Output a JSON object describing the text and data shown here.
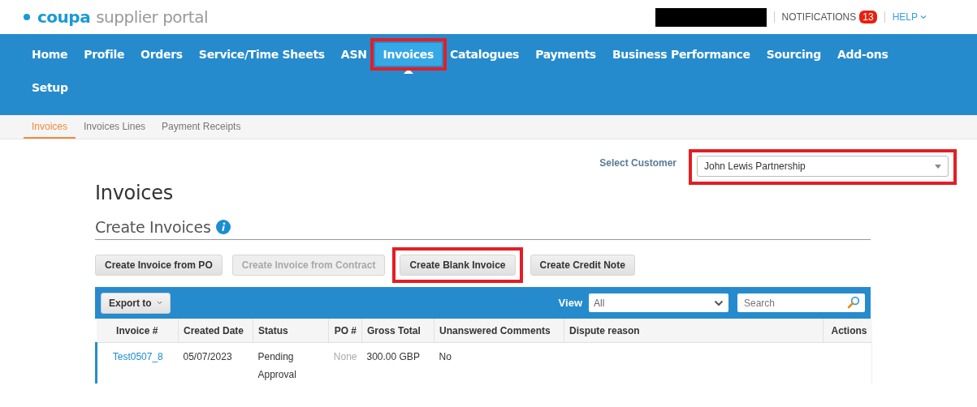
{
  "header": {
    "logo_brand": "coupa",
    "logo_product": "supplier portal",
    "user_redacted": true,
    "notifications": {
      "label": "NOTIFICATIONS",
      "count": "13"
    },
    "help": "HELP"
  },
  "nav": {
    "rows": [
      [
        {
          "label": "Home",
          "selected": false,
          "highlighted": false
        },
        {
          "label": "Profile",
          "selected": false,
          "highlighted": false
        },
        {
          "label": "Orders",
          "selected": false,
          "highlighted": false
        },
        {
          "label": "Service/Time Sheets",
          "selected": false,
          "highlighted": false
        },
        {
          "label": "ASN",
          "selected": false,
          "highlighted": false
        },
        {
          "label": "Invoices",
          "selected": true,
          "highlighted": true
        },
        {
          "label": "Catalogues",
          "selected": false,
          "highlighted": false
        },
        {
          "label": "Payments",
          "selected": false,
          "highlighted": false
        },
        {
          "label": "Business Performance",
          "selected": false,
          "highlighted": false
        },
        {
          "label": "Sourcing",
          "selected": false,
          "highlighted": false
        },
        {
          "label": "Add-ons",
          "selected": false,
          "highlighted": false
        }
      ],
      [
        {
          "label": "Setup",
          "selected": false,
          "highlighted": false
        }
      ]
    ]
  },
  "subnav": [
    {
      "label": "Invoices",
      "selected": true
    },
    {
      "label": "Invoices Lines",
      "selected": false
    },
    {
      "label": "Payment Receipts",
      "selected": false
    }
  ],
  "customer": {
    "label": "Select Customer",
    "value": "John Lewis Partnership",
    "highlighted": true
  },
  "title": "Invoices",
  "section": {
    "title": "Create Invoices"
  },
  "buttons": [
    {
      "label": "Create Invoice from PO",
      "disabled": false,
      "highlighted": false
    },
    {
      "label": "Create Invoice from Contract",
      "disabled": true,
      "highlighted": false
    },
    {
      "label": "Create Blank Invoice",
      "disabled": false,
      "highlighted": true
    },
    {
      "label": "Create Credit Note",
      "disabled": false,
      "highlighted": false
    }
  ],
  "table": {
    "export": "Export to",
    "view_label": "View",
    "view_value": "All",
    "search_placeholder": "Search",
    "columns": [
      {
        "label": "Invoice #"
      },
      {
        "label": "Created Date"
      },
      {
        "label": "Status"
      },
      {
        "label": "PO #"
      },
      {
        "label": "Gross Total"
      },
      {
        "label": "Unanswered Comments"
      },
      {
        "label": "Dispute reason"
      },
      {
        "label": "Actions"
      }
    ],
    "rows": [
      {
        "cells": [
          {
            "text": "Test0507_8",
            "kind": "link"
          },
          {
            "text": "05/07/2023",
            "kind": "text"
          },
          {
            "text": "Pending Approval",
            "kind": "text"
          },
          {
            "text": "None",
            "kind": "muted"
          },
          {
            "text": "300.00 GBP",
            "kind": "text"
          },
          {
            "text": "No",
            "kind": "text"
          }
        ]
      }
    ]
  }
}
